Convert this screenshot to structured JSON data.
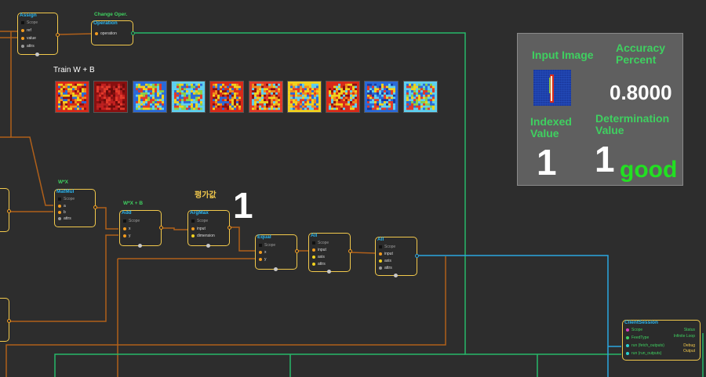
{
  "nodes": {
    "assign": {
      "title": "Assign",
      "scope": "Scope",
      "ref": "ref",
      "value": "value",
      "attrs": "attrs"
    },
    "operation": {
      "title": "Operation",
      "label": "Change Oper.",
      "operation": "operation"
    },
    "matmul": {
      "title": "MatMul",
      "label": "W*X",
      "scope": "Scope",
      "a": "a",
      "b": "b",
      "attrs": "attrs"
    },
    "add": {
      "title": "Add",
      "label": "W*X + B",
      "scope": "Scope",
      "x": "x",
      "y": "y"
    },
    "argmax": {
      "title": "ArgMax",
      "label": "평가값",
      "scope": "Scope",
      "input": "input",
      "dimension": "dimension"
    },
    "equal": {
      "title": "Equal",
      "scope": "Scope",
      "x": "x",
      "y": "y"
    },
    "all1": {
      "title": "All",
      "scope": "Scope",
      "input": "input",
      "axis": "axis",
      "attrs": "attrs"
    },
    "all2": {
      "title": "All",
      "scope": "Scope",
      "input": "input",
      "axis": "axis",
      "attrs": "attrs"
    },
    "session": {
      "title": "ClientSession",
      "scope": "Scope",
      "feedtype": "FeedType",
      "fetch": "run (fetch_outputs)",
      "runout": "run (run_outputs)",
      "status": "Status",
      "loop": "Infinite Loop",
      "debug": "Debug",
      "output": "Output"
    }
  },
  "argmax_value": "1",
  "train_label": "Train W + B",
  "thumbnails": [
    {
      "name": "weight-image-1",
      "colors": [
        "#d92a1a",
        "#f28c1e",
        "#f2d21e",
        "#2a6ad9",
        "#8a1010"
      ]
    },
    {
      "name": "weight-image-2",
      "colors": [
        "#8a1010",
        "#c21f1f",
        "#e23a2a",
        "#6a0c0c",
        "#b02020"
      ]
    },
    {
      "name": "weight-image-3",
      "colors": [
        "#2a6ad9",
        "#f2d21e",
        "#e23a2a",
        "#5ed0f0",
        "#8ad14a"
      ]
    },
    {
      "name": "weight-image-4",
      "colors": [
        "#5ed0f0",
        "#2a6ad9",
        "#f2d21e",
        "#8ad14a",
        "#e23a2a"
      ]
    },
    {
      "name": "weight-image-5",
      "colors": [
        "#d92a1a",
        "#f28c1e",
        "#8a1010",
        "#2a6ad9",
        "#f2d21e"
      ]
    },
    {
      "name": "weight-image-6",
      "colors": [
        "#e23a2a",
        "#f28c1e",
        "#5ed0f0",
        "#8a1010",
        "#f2d21e"
      ]
    },
    {
      "name": "weight-image-7",
      "colors": [
        "#f2d21e",
        "#2a6ad9",
        "#e23a2a",
        "#5ed0f0",
        "#f28c1e"
      ]
    },
    {
      "name": "weight-image-8",
      "colors": [
        "#d92a1a",
        "#f28c1e",
        "#8a1010",
        "#f2d21e",
        "#5ed0f0"
      ]
    },
    {
      "name": "weight-image-9",
      "colors": [
        "#2a6ad9",
        "#5ed0f0",
        "#e23a2a",
        "#f2d21e",
        "#1a3aa0"
      ]
    },
    {
      "name": "weight-image-10",
      "colors": [
        "#5ed0f0",
        "#f2d21e",
        "#2a6ad9",
        "#e23a2a",
        "#8ad14a"
      ]
    }
  ],
  "panel": {
    "input_image_label": "Input Image",
    "accuracy_label": "Accuracy\nPercent",
    "accuracy_value": "0.8000",
    "indexed_label": "Indexed\nValue",
    "indexed_value": "1",
    "determination_label": "Determination\nValue",
    "determination_value": "1",
    "verdict": "good"
  },
  "colors": {
    "background": "#2d2d2d",
    "node_border": "#f2c94c",
    "node_title": "#2bb6f0",
    "wire_orange": "#b0601a",
    "wire_green": "#27b86a",
    "wire_blue": "#2ba6e0",
    "panel_green": "#3fd060"
  }
}
